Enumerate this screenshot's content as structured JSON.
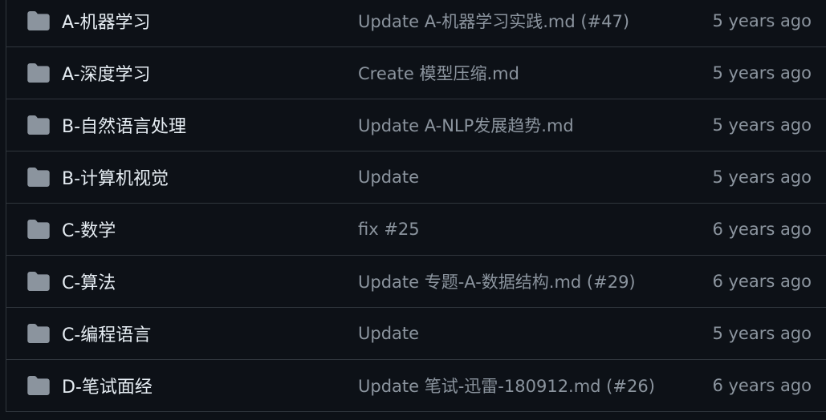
{
  "colors": {
    "background": "#0d1117",
    "border": "#30363d",
    "folder": "#8b949e",
    "name_text": "#e6edf3",
    "muted_text": "#8b949e"
  },
  "rows": [
    {
      "icon": "folder-icon",
      "name": "A-机器学习",
      "commit": "Update A-机器学习实践.md (#47)",
      "age": "5 years ago"
    },
    {
      "icon": "folder-icon",
      "name": "A-深度学习",
      "commit": "Create 模型压缩.md",
      "age": "5 years ago"
    },
    {
      "icon": "folder-icon",
      "name": "B-自然语言处理",
      "commit": "Update A-NLP发展趋势.md",
      "age": "5 years ago"
    },
    {
      "icon": "folder-icon",
      "name": "B-计算机视觉",
      "commit": "Update",
      "age": "5 years ago"
    },
    {
      "icon": "folder-icon",
      "name": "C-数学",
      "commit": "fix #25",
      "age": "6 years ago"
    },
    {
      "icon": "folder-icon",
      "name": "C-算法",
      "commit": "Update 专题-A-数据结构.md (#29)",
      "age": "6 years ago"
    },
    {
      "icon": "folder-icon",
      "name": "C-编程语言",
      "commit": "Update",
      "age": "5 years ago"
    },
    {
      "icon": "folder-icon",
      "name": "D-笔试面经",
      "commit": "Update 笔试-迅雷-180912.md (#26)",
      "age": "6 years ago"
    }
  ]
}
